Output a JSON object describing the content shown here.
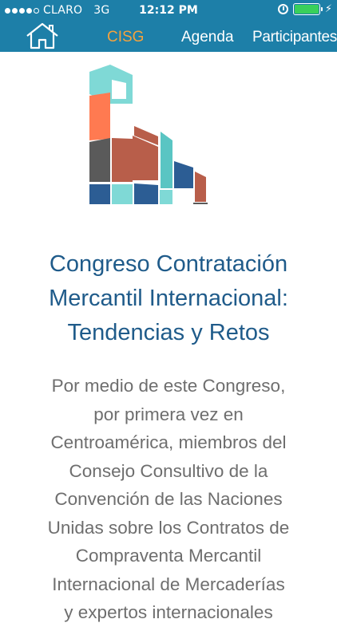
{
  "status_bar": {
    "carrier": "CLARO",
    "network": "3G",
    "time": "12:12 PM",
    "signal_dots_filled": 4,
    "signal_dots_total": 5,
    "battery_level": 1.0,
    "battery_color": "#39d05b"
  },
  "nav": {
    "home_icon": "home-icon",
    "items": [
      {
        "label": "CISG",
        "active": true,
        "color": "#f4a23d"
      },
      {
        "label": "Agenda",
        "active": false
      },
      {
        "label": "Participantes",
        "active": false
      }
    ],
    "background": "#1d7fa8"
  },
  "main": {
    "title_lines": [
      "Congreso Contratación",
      "Mercantil Internacional:",
      "Tendencias y Retos"
    ],
    "description_lines": [
      "Por medio de este Congreso,",
      "por primera vez en",
      "Centroamérica, miembros del",
      "Consejo Consultivo de la",
      "Convención de las Naciones",
      "Unidas sobre los Contratos de",
      "Compraventa Mercantil",
      "Internacional de Mercaderías",
      "y expertos internacionales"
    ],
    "title_color": "#1f5b8a",
    "text_color": "#6e6e6e"
  }
}
